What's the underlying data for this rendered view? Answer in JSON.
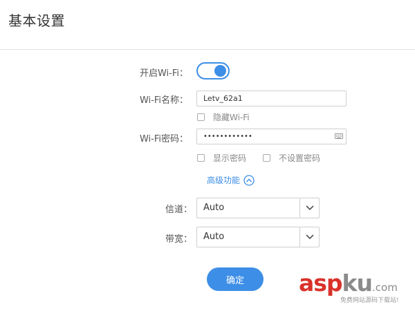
{
  "page": {
    "title": "基本设置"
  },
  "wifi_enable": {
    "label": "开启Wi-Fi：",
    "on": true
  },
  "wifi_name": {
    "label": "Wi-Fi名称：",
    "value": "Letv_62a1",
    "hide_label": "隐藏Wi-Fi",
    "hide_checked": false
  },
  "wifi_password": {
    "label": "Wi-Fi密码：",
    "masked_value": "••••••••••••",
    "show_password_label": "显示密码",
    "show_password_checked": false,
    "no_password_label": "不设置密码",
    "no_password_checked": false
  },
  "advanced": {
    "label": "高级功能"
  },
  "channel": {
    "label": "信道：",
    "selected": "Auto"
  },
  "bandwidth": {
    "label": "带宽：",
    "selected": "Auto"
  },
  "actions": {
    "confirm_label": "确定"
  },
  "watermark": {
    "main_red": "asp",
    "main_gray": "ku",
    "domain_suffix": ".com",
    "subtitle": "免费网站源码下载站!"
  },
  "colors": {
    "accent": "#3d8ee6",
    "watermark_red": "#d9322a"
  }
}
